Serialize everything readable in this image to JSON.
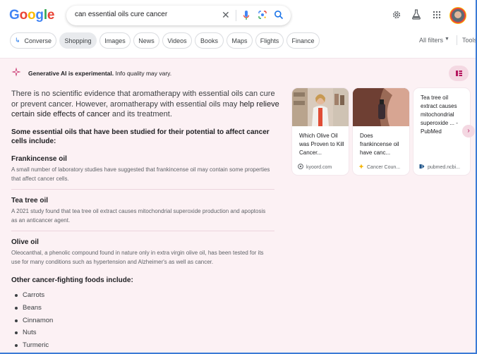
{
  "search": {
    "query": "can essential oils cure cancer"
  },
  "logo": {
    "letters": [
      "G",
      "o",
      "o",
      "g",
      "l",
      "e"
    ],
    "colors": [
      "#4285f4",
      "#ea4335",
      "#fbbc05",
      "#4285f4",
      "#34a853",
      "#ea4335"
    ]
  },
  "chips": [
    {
      "label": "Converse",
      "icon": "arrow-icon"
    },
    {
      "label": "Shopping",
      "active": true
    },
    {
      "label": "Images"
    },
    {
      "label": "News"
    },
    {
      "label": "Videos"
    },
    {
      "label": "Books"
    },
    {
      "label": "Maps"
    },
    {
      "label": "Flights"
    },
    {
      "label": "Finance"
    }
  ],
  "filters": {
    "all_filters": "All filters",
    "tools": "Tools"
  },
  "ai": {
    "heading_bold": "Generative AI is experimental.",
    "heading_rest": " Info quality may vary.",
    "intro_1": "There is no scientific evidence that aromatherapy with essential oils can cure or prevent cancer. However, aromatherapy with essential oils may ",
    "intro_bold": "help relieve certain side effects of cancer",
    "intro_2": " and its treatment.",
    "studied_heading": "Some essential oils that have been studied for their potential to affect cancer cells include:",
    "oils": [
      {
        "name": "Frankincense oil",
        "desc": "A small number of laboratory studies have suggested that frankincense oil may contain some properties that affect cancer cells."
      },
      {
        "name": "Tea tree oil",
        "desc": "A 2021 study found that tea tree oil extract causes mitochondrial superoxide production and apoptosis as an anticancer agent."
      },
      {
        "name": "Olive oil",
        "desc": "Oleocanthal, a phenolic compound found in nature only in extra virgin olive oil, has been tested for its use for many conditions such as hypertension and Alzheimer's as well as cancer."
      }
    ],
    "foods_heading": "Other cancer-fighting foods include:",
    "foods": [
      "Carrots",
      "Beans",
      "Cinnamon",
      "Nuts",
      "Turmeric"
    ],
    "sources": [
      {
        "title": "Which Olive Oil was Proven to Kill Cancer...",
        "site": "kyoord.com",
        "has_image": true
      },
      {
        "title": "Does frankincense oil have canc...",
        "site": "Cancer Coun...",
        "has_image": true
      },
      {
        "title": "Tea tree oil extract causes mitochondrial superoxide ... - PubMed",
        "site": "pubmed.ncbi...",
        "has_image": false
      }
    ]
  },
  "colors": {
    "accent": "#1a73e8",
    "ai_bg": "#fcf1f4",
    "ai_pink": "#b5175f"
  }
}
